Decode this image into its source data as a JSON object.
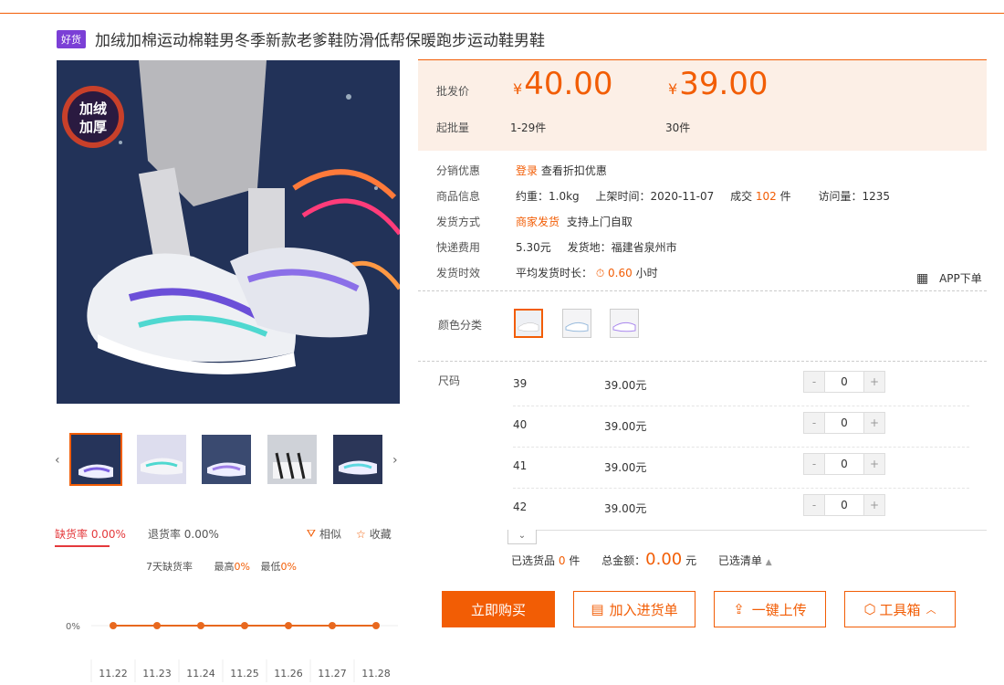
{
  "badge": "好货",
  "title": "加绒加棉运动棉鞋男冬季新款老爹鞋防滑低帮保暖跑步运动鞋男鞋",
  "promo_sticker": [
    "加绒",
    "加厚"
  ],
  "price": {
    "label": "批发价",
    "moq_label": "起批量",
    "tiers": [
      {
        "yen": "¥",
        "price": "40.00",
        "range": "1-29件"
      },
      {
        "yen": "¥",
        "price": "39.00",
        "range": "30件"
      }
    ]
  },
  "info": {
    "distribution": {
      "label": "分销优惠",
      "login": "登录",
      "text": "查看折扣优惠"
    },
    "product": {
      "label": "商品信息",
      "weight": "约重：1.0kg",
      "listed": "上架时间：2020-11-07",
      "deal_pre": "成交",
      "deal_num": "102",
      "deal_unit": "件",
      "visits": "访问量：1235"
    },
    "shipping": {
      "label": "发货方式",
      "method": "商家发货",
      "pickup": "支持上门自取"
    },
    "express": {
      "label": "快递费用",
      "fee": "5.30元",
      "origin": "发货地：福建省泉州市"
    },
    "timing": {
      "label": "发货时效",
      "text": "平均发货时长：",
      "hours": "0.60",
      "unit": "小时"
    },
    "app": "APP下单"
  },
  "color": {
    "label": "颜色分类"
  },
  "size": {
    "label": "尺码",
    "rows": [
      {
        "size": "39",
        "price": "39.00元",
        "qty": "0"
      },
      {
        "size": "40",
        "price": "39.00元",
        "qty": "0"
      },
      {
        "size": "41",
        "price": "39.00元",
        "qty": "0"
      },
      {
        "size": "42",
        "price": "39.00元",
        "qty": "0"
      }
    ],
    "minus": "-",
    "plus": "+"
  },
  "summary": {
    "selected_pre": "已选货品",
    "selected_num": "0",
    "selected_unit": "件",
    "total_label": "总金额：",
    "total": "0.00",
    "total_unit": "元",
    "list": "已选清单"
  },
  "buttons": {
    "buy": "立即购买",
    "add_list": "加入进货单",
    "upload": "一键上传",
    "toolbox": "工具箱"
  },
  "stats": {
    "shortage": "缺货率 0.00%",
    "return": "退货率 0.00%",
    "similar": "相似",
    "favorite": "收藏",
    "seven_day": "7天缺货率",
    "high_label": "最高",
    "high": "0%",
    "low_label": "最低",
    "low": "0%"
  },
  "chart_data": {
    "type": "line",
    "categories": [
      "11.22",
      "11.23",
      "11.24",
      "11.25",
      "11.26",
      "11.27",
      "11.28"
    ],
    "values": [
      0,
      0,
      0,
      0,
      0,
      0,
      0
    ],
    "yticks": [
      "0%"
    ],
    "color": "#e8681e"
  },
  "colors": {
    "accent": "#f25d05",
    "badge": "#7b3fd6"
  }
}
